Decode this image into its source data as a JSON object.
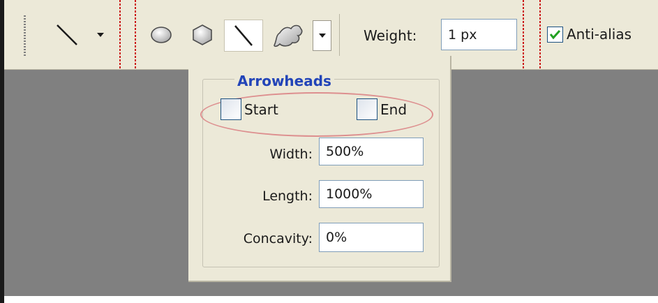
{
  "toolbar": {
    "weight_label": "Weight:",
    "weight_value": "1 px",
    "antialias_label": "Anti-alias",
    "antialias_checked": true
  },
  "arrowheads_panel": {
    "title": "Arrowheads",
    "start_label": "Start",
    "start_checked": false,
    "end_label": "End",
    "end_checked": false,
    "width_label": "Width:",
    "width_value": "500%",
    "length_label": "Length:",
    "length_value": "1000%",
    "concavity_label": "Concavity:",
    "concavity_value": "0%"
  },
  "icons": [
    "line-tool-icon",
    "dropdown-arrow-icon",
    "ellipse-icon",
    "polygon-icon",
    "line-icon",
    "custom-shape-icon",
    "checkmark-icon"
  ],
  "colors": {
    "panel_bg": "#ece9d8",
    "canvas_bg": "#808080",
    "title_blue": "#2244b8",
    "highlight_ellipse": "#dd8f8f",
    "separator_red": "#cc1a1a"
  }
}
